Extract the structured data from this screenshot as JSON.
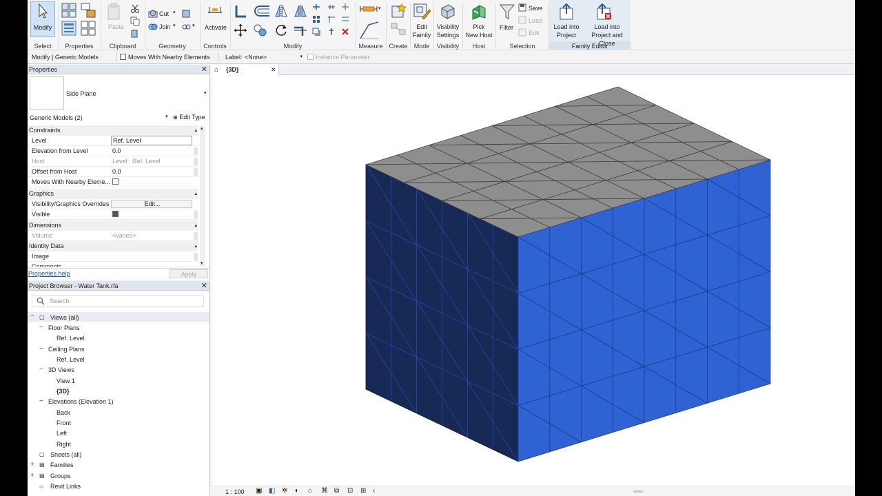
{
  "ribbon": {
    "panels": {
      "select": "Select",
      "properties": "Properties",
      "clipboard": "Clipboard",
      "geometry": "Geometry",
      "controls": "Controls",
      "modify": "Modify",
      "measure": "Measure",
      "create": "Create",
      "mode": "Mode",
      "visibility": "Visibility",
      "host": "Host",
      "selection": "Selection",
      "family_editor": "Family Editor"
    },
    "modify_label": "Modify",
    "paste_label": "Paste",
    "cut_label": "Cut",
    "join_label": "Join",
    "activate_label": "Activate",
    "edit_family": [
      "Edit",
      "Family"
    ],
    "visibility_settings": [
      "Visibility",
      "Settings"
    ],
    "pick_new_host": [
      "Pick",
      "New Host"
    ],
    "filter_label": "Filter",
    "save_label": "Save",
    "load_label": "Load",
    "edit_label": "Edit",
    "load_into_project": [
      "Load into",
      "Project"
    ],
    "load_into_project_close": [
      "Load into",
      "Project and Close"
    ]
  },
  "optbar": {
    "context": "Modify | Generic Models",
    "moves_with": "Moves With Nearby Elements",
    "label_caption": "Label:",
    "label_value": "<None>",
    "instance_param": "Instance Parameter"
  },
  "properties": {
    "title": "Properties",
    "type_name": "Side Plane",
    "selector": "Generic Models (2)",
    "edit_type": "Edit Type",
    "groups": {
      "constraints": "Constraints",
      "graphics": "Graphics",
      "dimensions": "Dimensions",
      "identity": "Identity Data"
    },
    "rows": {
      "level": {
        "name": "Level",
        "value": "Ref. Level"
      },
      "elevation": {
        "name": "Elevation from Level",
        "value": "0.0"
      },
      "host": {
        "name": "Host",
        "value": "Level : Ref. Level"
      },
      "offset": {
        "name": "Offset from Host",
        "value": "0.0"
      },
      "moves": {
        "name": "Moves With Nearby Eleme..."
      },
      "vis_overrides": {
        "name": "Visibility/Graphics Overrides",
        "value": "Edit..."
      },
      "visible": {
        "name": "Visible"
      },
      "volume": {
        "name": "Volume",
        "value": "<varies>"
      },
      "image": {
        "name": "Image"
      },
      "comments": {
        "name": "Comments"
      }
    },
    "help": "Properties help",
    "apply": "Apply"
  },
  "browser": {
    "title": "Project Browser - Water Tank.rfa",
    "search_placeholder": "Search",
    "views_all": "Views (all)",
    "floor_plans": "Floor Plans",
    "fp_ref": "Ref. Level",
    "ceiling_plans": "Ceiling Plans",
    "cp_ref": "Ref. Level",
    "views_3d": "3D Views",
    "view1": "View 1",
    "view3d": "{3D}",
    "elevations": "Elevations (Elevation 1)",
    "back": "Back",
    "front": "Front",
    "left": "Left",
    "right": "Right",
    "sheets": "Sheets (all)",
    "families": "Families",
    "groups": "Groups",
    "revit_links": "Revit Links"
  },
  "view": {
    "tab": "{3D}",
    "scale": "1 : 100"
  },
  "colors": {
    "top_face": "#8e8e8e",
    "front_face": "#2f62d2",
    "left_face": "#172a55",
    "accent": "#cfe3f5"
  }
}
